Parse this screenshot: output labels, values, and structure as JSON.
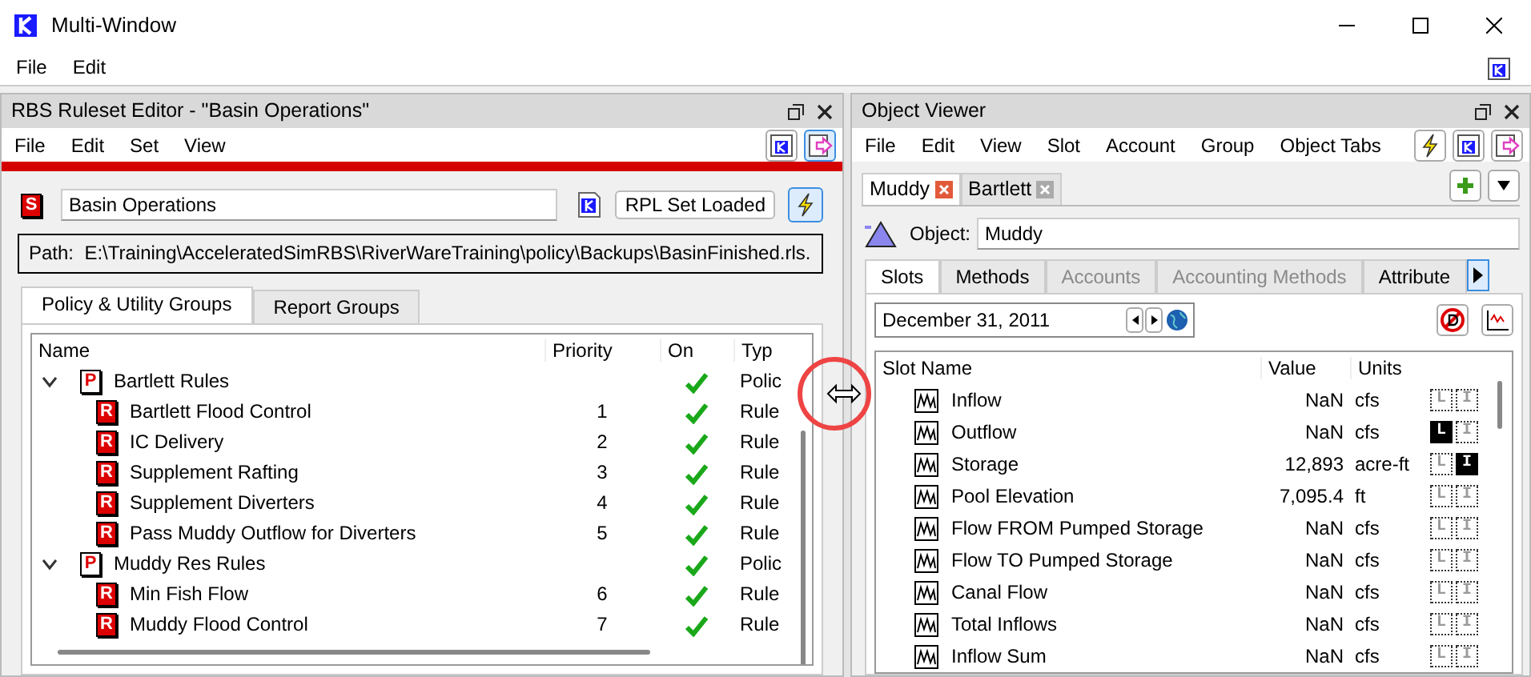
{
  "window": {
    "title": "Multi-Window",
    "menu": [
      "File",
      "Edit"
    ]
  },
  "ruleset_editor": {
    "title": "RBS Ruleset Editor - \"Basin Operations\"",
    "menu": [
      "File",
      "Edit",
      "Set",
      "View"
    ],
    "set_icon_letter": "S",
    "set_name": "Basin Operations",
    "status_button": "RPL Set Loaded",
    "path": "Path:  E:\\Training\\AcceleratedSimRBS\\RiverWareTraining\\policy\\Backups\\BasinFinished.rls.",
    "tabs": [
      {
        "label": "Policy & Utility Groups",
        "selected": true
      },
      {
        "label": "Report Groups",
        "selected": false
      }
    ],
    "columns": [
      "Name",
      "Priority",
      "On",
      "Typ"
    ],
    "tree": [
      {
        "icon_letter": "P",
        "name": "Bartlett Rules",
        "on": true,
        "type": "Polic",
        "expanded": true,
        "children": [
          {
            "icon_letter": "R",
            "name": "Bartlett Flood Control",
            "priority": "1",
            "on": true,
            "type": "Rule"
          },
          {
            "icon_letter": "R",
            "name": "IC Delivery",
            "priority": "2",
            "on": true,
            "type": "Rule"
          },
          {
            "icon_letter": "R",
            "name": "Supplement Rafting",
            "priority": "3",
            "on": true,
            "type": "Rule"
          },
          {
            "icon_letter": "R",
            "name": "Supplement Diverters",
            "priority": "4",
            "on": true,
            "type": "Rule"
          },
          {
            "icon_letter": "R",
            "name": "Pass Muddy Outflow for Diverters",
            "priority": "5",
            "on": true,
            "type": "Rule"
          }
        ]
      },
      {
        "icon_letter": "P",
        "name": "Muddy Res Rules",
        "on": true,
        "type": "Polic",
        "expanded": true,
        "children": [
          {
            "icon_letter": "R",
            "name": "Min Fish Flow",
            "priority": "6",
            "on": true,
            "type": "Rule"
          },
          {
            "icon_letter": "R",
            "name": "Muddy Flood Control",
            "priority": "7",
            "on": true,
            "type": "Rule"
          }
        ]
      }
    ]
  },
  "object_viewer": {
    "title": "Object Viewer",
    "menu": [
      "File",
      "Edit",
      "View",
      "Slot",
      "Account",
      "Group",
      "Object Tabs"
    ],
    "object_tabs": [
      {
        "label": "Muddy",
        "selected": true
      },
      {
        "label": "Bartlett",
        "selected": false
      }
    ],
    "object_label": "Object:",
    "object_name": "Muddy",
    "tabs": [
      {
        "label": "Slots",
        "selected": true,
        "disabled": false
      },
      {
        "label": "Methods",
        "selected": false,
        "disabled": false
      },
      {
        "label": "Accounts",
        "selected": false,
        "disabled": true
      },
      {
        "label": "Accounting Methods",
        "selected": false,
        "disabled": true
      },
      {
        "label": "Attribute",
        "selected": false,
        "disabled": false
      }
    ],
    "date": "December 31, 2011",
    "columns": [
      "Slot Name",
      "Value",
      "Units"
    ],
    "slots": [
      {
        "name": "Inflow",
        "value": "NaN",
        "units": "cfs",
        "flags": [
          {
            "letter": "L",
            "on": false
          },
          {
            "letter": "I",
            "on": false
          }
        ]
      },
      {
        "name": "Outflow",
        "value": "NaN",
        "units": "cfs",
        "flags": [
          {
            "letter": "L",
            "on": true
          },
          {
            "letter": "I",
            "on": false
          }
        ]
      },
      {
        "name": "Storage",
        "value": "12,893",
        "units": "acre-ft",
        "flags": [
          {
            "letter": "L",
            "on": false
          },
          {
            "letter": "I",
            "on": true
          }
        ]
      },
      {
        "name": "Pool Elevation",
        "value": "7,095.4",
        "units": "ft",
        "flags": [
          {
            "letter": "L",
            "on": false
          },
          {
            "letter": "I",
            "on": false
          }
        ]
      },
      {
        "name": "Flow FROM Pumped Storage",
        "value": "NaN",
        "units": "cfs",
        "flags": [
          {
            "letter": "L",
            "on": false
          },
          {
            "letter": "I",
            "on": false
          }
        ]
      },
      {
        "name": "Flow TO Pumped Storage",
        "value": "NaN",
        "units": "cfs",
        "flags": [
          {
            "letter": "L",
            "on": false
          },
          {
            "letter": "I",
            "on": false
          }
        ]
      },
      {
        "name": "Canal Flow",
        "value": "NaN",
        "units": "cfs",
        "flags": [
          {
            "letter": "L",
            "on": false
          },
          {
            "letter": "I",
            "on": false
          }
        ]
      },
      {
        "name": "Total Inflows",
        "value": "NaN",
        "units": "cfs",
        "flags": [
          {
            "letter": "L",
            "on": false
          },
          {
            "letter": "I",
            "on": false
          }
        ]
      },
      {
        "name": "Inflow Sum",
        "value": "NaN",
        "units": "cfs",
        "flags": [
          {
            "letter": "L",
            "on": false
          },
          {
            "letter": "I",
            "on": false
          }
        ]
      }
    ]
  }
}
